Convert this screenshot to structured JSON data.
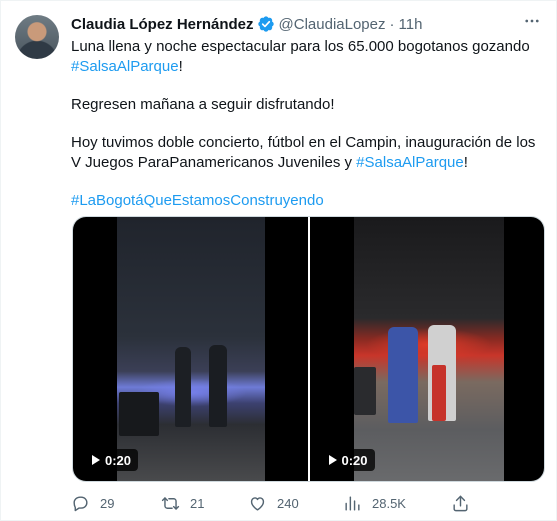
{
  "tweet": {
    "author_name": "Claudia López Hernández",
    "handle": "@ClaudiaLopez",
    "separator": "·",
    "time": "11h",
    "line1": "Luna llena y noche espectacular para los 65.000 bogotanos gozando",
    "hashtag1": "#SalsaAlParque",
    "line1_end": "!",
    "line2": "Regresen mañana a seguir disfrutando!",
    "line3": "Hoy tuvimos doble concierto, fútbol en el Campin, inauguración de los V Juegos ParaPanamericanos Juveniles y",
    "hashtag2": "#SalsaAlParque",
    "line3_end": "!",
    "hashtag3": "#LaBogotáQueEstamosConstruyendo"
  },
  "media": [
    {
      "duration": "0:20"
    },
    {
      "duration": "0:20"
    }
  ],
  "actions": {
    "replies": "29",
    "retweets": "21",
    "likes": "240",
    "views": "28.5K"
  },
  "colors": {
    "link": "#1d9bf0",
    "muted": "#536471",
    "text": "#0f1419",
    "verified": "#1d9bf0"
  },
  "icons": [
    "verified-icon",
    "more-icon",
    "play-icon",
    "reply-icon",
    "retweet-icon",
    "like-icon",
    "views-icon",
    "share-icon"
  ]
}
